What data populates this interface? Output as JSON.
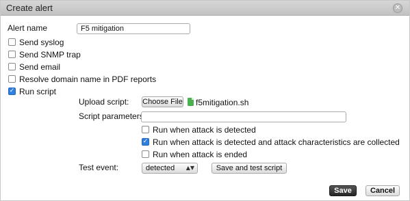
{
  "dialog": {
    "title": "Create alert",
    "close_glyph": "✕"
  },
  "alert_name": {
    "label": "Alert name",
    "value": "F5 mitigation"
  },
  "options": [
    {
      "label": "Send syslog",
      "checked": false
    },
    {
      "label": "Send SNMP trap",
      "checked": false
    },
    {
      "label": "Send email",
      "checked": false
    },
    {
      "label": "Resolve domain name in PDF reports",
      "checked": false
    },
    {
      "label": "Run script",
      "checked": true
    }
  ],
  "script": {
    "upload_label": "Upload script:",
    "choose_file_label": "Choose File",
    "file_name": "f5mitigation.sh",
    "file_icon": "script-file-icon",
    "parameters_label": "Script parameters:",
    "parameters_value": "",
    "run_options": [
      {
        "label": "Run when attack is detected",
        "checked": false
      },
      {
        "label": "Run when attack is detected and attack characteristics are collected",
        "checked": true
      },
      {
        "label": "Run when attack is ended",
        "checked": false
      }
    ],
    "test_event_label": "Test event:",
    "test_event_value": "detected",
    "save_test_label": "Save and test script"
  },
  "footer": {
    "save_label": "Save",
    "cancel_label": "Cancel"
  },
  "colors": {
    "checkbox_checked": "#2f7fe0",
    "file_icon": "#4caf50"
  }
}
